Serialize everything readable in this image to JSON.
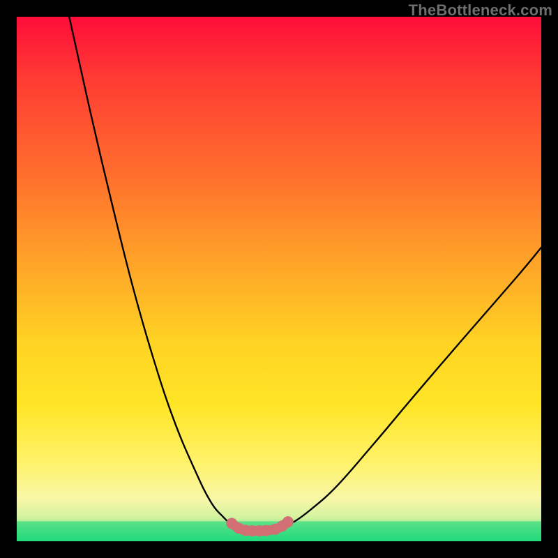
{
  "watermark": "TheBottleneck.com",
  "colors": {
    "black": "#000000",
    "curve": "#000000",
    "marker_fill": "#d26f74",
    "green_band": "#19d77a",
    "gradient_top": "#ff0d3a",
    "gradient_mid_orange": "#ff8a2a",
    "gradient_yellow": "#ffe526",
    "gradient_pale": "#f8f7a8",
    "gradient_bottom": "#2de07f"
  },
  "chart_data": {
    "type": "line",
    "title": "",
    "xlabel": "",
    "ylabel": "",
    "xlim": [
      0,
      100
    ],
    "ylim": [
      0,
      100
    ],
    "series": [
      {
        "name": "bottleneck-curve-left",
        "x": [
          10,
          14,
          18,
          22,
          26,
          30,
          34,
          37,
          39.5,
          41,
          42.5,
          44.5
        ],
        "y": [
          100,
          82,
          65,
          49,
          35,
          23,
          13.5,
          7.5,
          4.5,
          3.2,
          2.4,
          2.0
        ]
      },
      {
        "name": "bottleneck-curve-right",
        "x": [
          44.5,
          49,
          51,
          53,
          56,
          61,
          68,
          76,
          85,
          95,
          100
        ],
        "y": [
          2.0,
          2.2,
          2.8,
          3.8,
          6.0,
          10.5,
          18.5,
          28,
          38.5,
          50,
          56
        ]
      },
      {
        "name": "valley-markers",
        "x": [
          41.0,
          42.3,
          43.6,
          44.9,
          46.2,
          47.5,
          49.3,
          50.6,
          51.7
        ],
        "y": [
          3.4,
          2.5,
          2.1,
          2.0,
          2.0,
          2.05,
          2.3,
          2.9,
          3.7
        ]
      }
    ],
    "green_band": {
      "top_y": 3.8,
      "bottom_y": 0
    }
  }
}
